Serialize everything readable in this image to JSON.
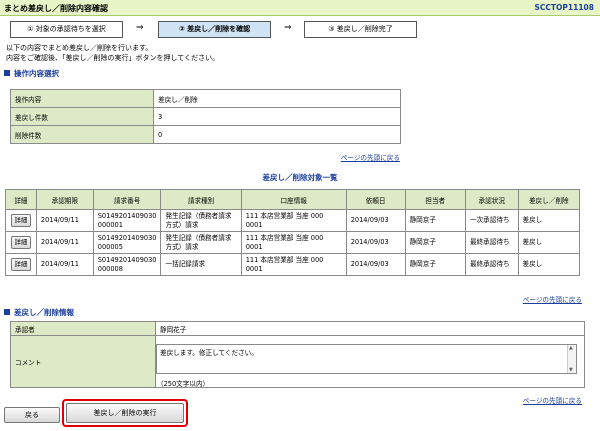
{
  "header": {
    "title": "まとめ差戻し／削除内容確認",
    "screen_id": "SCCTOP11108"
  },
  "steps": [
    {
      "label": "① 対象の承認待ちを選択"
    },
    {
      "label": "② 差戻し／削除を確認"
    },
    {
      "label": "③ 差戻し／削除完了"
    }
  ],
  "arrow": "⇒",
  "intro": {
    "line1": "以下の内容でまとめ差戻し／削除を行います。",
    "line2": "内容をご確認後、「差戻し／削除の実行」ボタンを押してください。"
  },
  "operation": {
    "section_title": "操作内容選択",
    "rows": [
      {
        "label": "操作内容",
        "value": "差戻し／削除"
      },
      {
        "label": "差戻し件数",
        "value": "3"
      },
      {
        "label": "削除件数",
        "value": "0"
      }
    ]
  },
  "page_top_link": "ページの先頭に戻る",
  "list": {
    "title": "差戻し／削除対象一覧",
    "headers": [
      "詳細",
      "承認期限",
      "請求番号",
      "請求種別",
      "口座情報",
      "依頼日",
      "担当者",
      "承認状況",
      "差戻し／削除"
    ],
    "detail_button": "詳細",
    "rows": [
      {
        "deadline": "2014/09/11",
        "number": "S0149201409030 000001",
        "kind": "発生記録（債務者請求方式）請求",
        "account": "111 本店営業部 当座 000 0001",
        "date": "2014/09/03",
        "person": "静岡京子",
        "status": "一次承認待ち",
        "action": "差戻し"
      },
      {
        "deadline": "2014/09/11",
        "number": "S0149201409030 000005",
        "kind": "発生記録（債務者請求方式）請求",
        "account": "111 本店営業部 当座 000 0001",
        "date": "2014/09/03",
        "person": "静岡京子",
        "status": "最終承認待ち",
        "action": "差戻し"
      },
      {
        "deadline": "2014/09/11",
        "number": "S0149201409030 000008",
        "kind": "一括記録請求",
        "account": "111 本店営業部 当座 000 0001",
        "date": "2014/09/03",
        "person": "静岡京子",
        "status": "最終承認待ち",
        "action": "差戻し"
      }
    ]
  },
  "info": {
    "section_title": "差戻し／削除情報",
    "approver_label": "承認者",
    "approver_value": "静岡花子",
    "comment_label": "コメント",
    "comment_value": "差戻します。修正してください。",
    "comment_hint": "（250文字以内）"
  },
  "buttons": {
    "back": "戻る",
    "execute": "差戻し／削除の実行"
  },
  "colors": {
    "title_bg": "#e7f5c7",
    "label_bg": "#dde9c7",
    "active_step": "#cfe3f4",
    "link": "#1b3f9e",
    "highlight": "#e00000"
  }
}
